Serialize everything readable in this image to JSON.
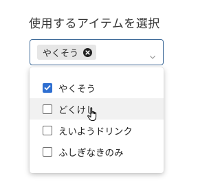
{
  "field": {
    "label": "使用するアイテムを選択"
  },
  "select": {
    "chips": [
      {
        "label": "やくそう"
      }
    ]
  },
  "dropdown": {
    "options": [
      {
        "label": "やくそう",
        "checked": true
      },
      {
        "label": "どくけし",
        "checked": false
      },
      {
        "label": "えいようドリンク",
        "checked": false
      },
      {
        "label": "ふしぎなきのみ",
        "checked": false
      }
    ]
  },
  "colors": {
    "accent": "#2f6fd1",
    "border_focus": "#3f6b99",
    "chip_bg": "#e6e6e6",
    "hover_bg": "#f1f1f1"
  },
  "icons": {
    "chip_remove": "close-circle-icon",
    "expand": "chevron-down-icon",
    "cursor": "hand-pointer-icon",
    "check": "check-icon"
  }
}
